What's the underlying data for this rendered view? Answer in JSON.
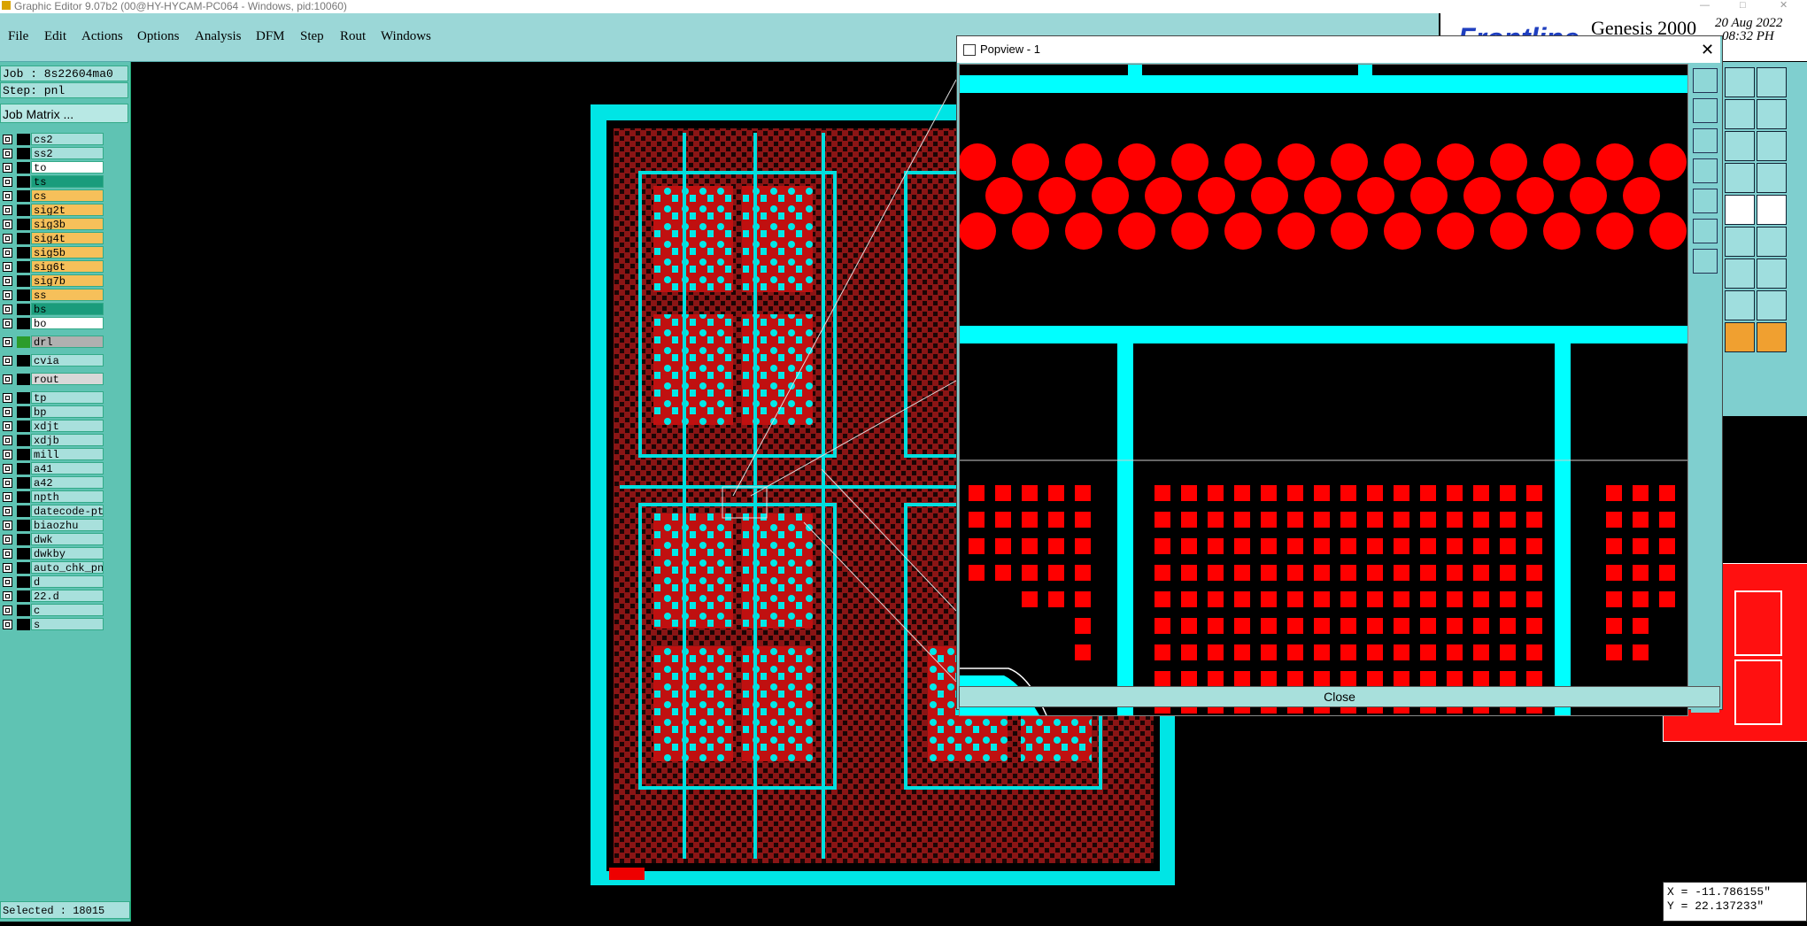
{
  "window_title": "Graphic Editor 9.07b2 (00@HY-HYCAM-PC064 - Windows, pid:10060)",
  "menu": [
    "File",
    "Edit",
    "Actions",
    "Options",
    "Analysis",
    "DFM",
    "Step",
    "Rout",
    "Windows"
  ],
  "brand": {
    "logo": "Frontline",
    "product": "Genesis 2000",
    "date": "20 Aug 2022",
    "time": "08:32 PH"
  },
  "job_label": "Job : 8s22604ma0",
  "step_label": "Step: pnl",
  "job_matrix_button": "Job Matrix ...",
  "layers": [
    {
      "name": "cs2",
      "color": "#a8e0dc"
    },
    {
      "name": "ss2",
      "color": "#a8e0dc"
    },
    {
      "name": "to",
      "color": "#ffffff"
    },
    {
      "name": "ts",
      "color": "#1a9c7c"
    },
    {
      "name": "cs",
      "color": "#f6c05a"
    },
    {
      "name": "sig2t",
      "color": "#f6c05a"
    },
    {
      "name": "sig3b",
      "color": "#f6c05a"
    },
    {
      "name": "sig4t",
      "color": "#f6c05a"
    },
    {
      "name": "sig5b",
      "color": "#f6c05a"
    },
    {
      "name": "sig6t",
      "color": "#f6c05a"
    },
    {
      "name": "sig7b",
      "color": "#f6c05a"
    },
    {
      "name": "ss",
      "color": "#f6c05a"
    },
    {
      "name": "bs",
      "color": "#1a9c7c"
    },
    {
      "name": "bo",
      "color": "#ffffff"
    },
    {
      "name": "drl",
      "color": "#b0b0b0"
    },
    {
      "name": "cvia",
      "color": "#a8e0dc"
    },
    {
      "name": "rout",
      "color": "#d8d8d8"
    },
    {
      "name": "tp",
      "color": "#a8e0dc"
    },
    {
      "name": "bp",
      "color": "#a8e0dc"
    },
    {
      "name": "xdjt",
      "color": "#a8e0dc"
    },
    {
      "name": "xdjb",
      "color": "#a8e0dc"
    },
    {
      "name": "mill",
      "color": "#a8e0dc"
    },
    {
      "name": "a41",
      "color": "#a8e0dc"
    },
    {
      "name": "a42",
      "color": "#a8e0dc"
    },
    {
      "name": "npth",
      "color": "#a8e0dc"
    },
    {
      "name": "datecode-pts",
      "color": "#a8e0dc"
    },
    {
      "name": "biaozhu",
      "color": "#a8e0dc"
    },
    {
      "name": "dwk",
      "color": "#a8e0dc"
    },
    {
      "name": "dwkby",
      "color": "#a8e0dc"
    },
    {
      "name": "auto_chk_pn",
      "color": "#a8e0dc"
    },
    {
      "name": "d",
      "color": "#a8e0dc"
    },
    {
      "name": "22.d",
      "color": "#a8e0dc"
    },
    {
      "name": "c",
      "color": "#a8e0dc"
    },
    {
      "name": "s",
      "color": "#a8e0dc"
    }
  ],
  "status_selected": "Selected : 18015",
  "popview": {
    "title": "Popview - 1",
    "close_label": "Close"
  },
  "coords": {
    "x": "X = -11.786155\"",
    "y": "Y = 22.137233\""
  },
  "colors": {
    "cyan": "#00ffff",
    "red": "#ff0000",
    "panel": "#5fc3b3",
    "menu": "#9bd7d7"
  }
}
